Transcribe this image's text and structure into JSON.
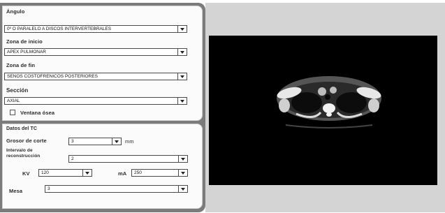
{
  "colors": {
    "frame": "#7b7b7b",
    "panel": "#fbfbfb",
    "viewer_bg": "#d4d4d4",
    "viewer": "#000000"
  },
  "angle": {
    "label": "Ángulo",
    "value": "0º O PARALELO A DISCOS INTERVERTEBRALES"
  },
  "start_zone": {
    "label": "Zona de inicio",
    "value": "APEX PULMONAR"
  },
  "end_zone": {
    "label": "Zona de fin",
    "value": "SENOS COSTOFRENICOS POSTERIORES"
  },
  "section": {
    "label": "Sección",
    "value": "AXIAL"
  },
  "bone_window": {
    "label": "Ventana ósea",
    "checked": false
  },
  "ct_data": {
    "title": "Datos del TC",
    "thickness": {
      "label": "Grosor de corte",
      "value": "3",
      "unit": "mm"
    },
    "interval": {
      "label_line1": "Intervalo de",
      "label_line2": "reconstrucción",
      "value": "2"
    },
    "kv": {
      "label": "KV",
      "value": "120"
    },
    "ma": {
      "label": "mA",
      "value": "250"
    },
    "table": {
      "label": "Mesa",
      "value": "3"
    }
  },
  "viewer": {
    "image": "axial-ct-thorax-slice"
  }
}
